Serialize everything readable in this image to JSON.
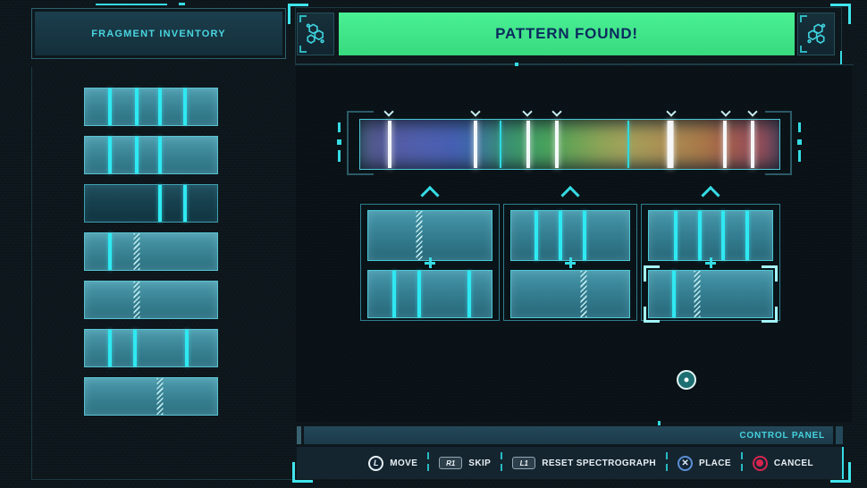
{
  "header": {
    "title": "FRAGMENT INVENTORY"
  },
  "banner": {
    "text": "PATTERN FOUND!",
    "bg_color": "#3fe98c",
    "text_color": "#0c2a5e"
  },
  "colors": {
    "accent_cyan": "#36dbe3",
    "bright_line": "#2fe9f2",
    "cross_blue": "#5b8fd6",
    "circle_red": "#d6254d"
  },
  "icons": {
    "left": "molecule-icon",
    "right": "molecule-icon",
    "spectro_marker": "chevron-down-icon",
    "column_marker": "chevron-up-icon",
    "combine": "plus-icon"
  },
  "sidebar": {
    "fragments": [
      {
        "variant": "normal",
        "lines": [
          {
            "pct": 19,
            "type": "solid"
          },
          {
            "pct": 39,
            "type": "solid"
          },
          {
            "pct": 57,
            "type": "solid"
          },
          {
            "pct": 76,
            "type": "solid"
          }
        ]
      },
      {
        "variant": "normal",
        "lines": [
          {
            "pct": 19,
            "type": "solid"
          },
          {
            "pct": 39,
            "type": "solid"
          },
          {
            "pct": 57,
            "type": "solid"
          }
        ]
      },
      {
        "variant": "dark",
        "lines": [
          {
            "pct": 57,
            "type": "solid"
          },
          {
            "pct": 76,
            "type": "solid"
          }
        ]
      },
      {
        "variant": "normal",
        "lines": [
          {
            "pct": 19,
            "type": "solid"
          },
          {
            "pct": 39,
            "type": "hatched"
          }
        ]
      },
      {
        "variant": "normal",
        "lines": [
          {
            "pct": 39,
            "type": "hatched"
          }
        ]
      },
      {
        "variant": "normal",
        "lines": [
          {
            "pct": 19,
            "type": "solid"
          },
          {
            "pct": 38,
            "type": "solid"
          },
          {
            "pct": 77,
            "type": "solid"
          }
        ]
      },
      {
        "variant": "normal",
        "lines": [
          {
            "pct": 57,
            "type": "hatched"
          }
        ]
      }
    ]
  },
  "spectrograph": {
    "gradient": [
      {
        "pos": 0,
        "color": "#35506b"
      },
      {
        "pos": 3,
        "color": "#50568b"
      },
      {
        "pos": 8,
        "color": "#545ca4"
      },
      {
        "pos": 15,
        "color": "#4f5fae"
      },
      {
        "pos": 22,
        "color": "#465fb2"
      },
      {
        "pos": 26,
        "color": "#3f66ab"
      },
      {
        "pos": 29,
        "color": "#3d7996"
      },
      {
        "pos": 33,
        "color": "#398a7d"
      },
      {
        "pos": 38,
        "color": "#3d9869"
      },
      {
        "pos": 44,
        "color": "#47a15d"
      },
      {
        "pos": 50,
        "color": "#66a356"
      },
      {
        "pos": 57,
        "color": "#8ba457"
      },
      {
        "pos": 63,
        "color": "#a3a15a"
      },
      {
        "pos": 70,
        "color": "#a99455"
      },
      {
        "pos": 76,
        "color": "#aa8750"
      },
      {
        "pos": 82,
        "color": "#a87647"
      },
      {
        "pos": 87,
        "color": "#a2614b"
      },
      {
        "pos": 91,
        "color": "#9b5454"
      },
      {
        "pos": 96,
        "color": "#8c4b57"
      },
      {
        "pos": 100,
        "color": "#4f3a4f"
      }
    ],
    "markers": [
      {
        "pct": 7,
        "w": 4
      },
      {
        "pct": 27.5,
        "w": 4
      },
      {
        "pct": 40,
        "w": 4
      },
      {
        "pct": 47,
        "w": 4
      },
      {
        "pct": 74,
        "w": 7
      },
      {
        "pct": 87,
        "w": 4
      },
      {
        "pct": 93.5,
        "w": 4
      }
    ],
    "dividers": [
      33.5,
      64
    ]
  },
  "puzzle": {
    "columns": [
      {
        "top": {
          "lines": [
            {
              "pct": 41,
              "type": "hatched"
            }
          ],
          "selected": false
        },
        "bottom": {
          "lines": [
            {
              "pct": 21,
              "type": "solid"
            },
            {
              "pct": 41,
              "type": "solid"
            },
            {
              "pct": 82,
              "type": "solid"
            }
          ],
          "selected": false
        }
      },
      {
        "top": {
          "lines": [
            {
              "pct": 21,
              "type": "solid"
            },
            {
              "pct": 42,
              "type": "solid"
            },
            {
              "pct": 62,
              "type": "solid"
            }
          ],
          "selected": false
        },
        "bottom": {
          "lines": [
            {
              "pct": 61,
              "type": "hatched"
            }
          ],
          "selected": false
        }
      },
      {
        "top": {
          "lines": [
            {
              "pct": 22,
              "type": "solid"
            },
            {
              "pct": 41,
              "type": "solid"
            },
            {
              "pct": 60,
              "type": "solid"
            },
            {
              "pct": 80,
              "type": "solid"
            }
          ],
          "selected": false
        },
        "bottom": {
          "lines": [
            {
              "pct": 20,
              "type": "solid"
            },
            {
              "pct": 39,
              "type": "hatched"
            }
          ],
          "selected": true
        }
      }
    ]
  },
  "control_panel": {
    "label": "CONTROL PANEL",
    "buttons": [
      {
        "icon": "l-stick-icon",
        "key": "L",
        "label": "MOVE"
      },
      {
        "icon": "r1-button-icon",
        "key": "R1",
        "label": "SKIP"
      },
      {
        "icon": "l1-button-icon",
        "key": "L1",
        "label": "RESET SPECTROGRAPH"
      },
      {
        "icon": "cross-button-icon",
        "key": "✕",
        "label": "PLACE"
      },
      {
        "icon": "circle-button-icon",
        "key": "",
        "label": "CANCEL"
      }
    ]
  }
}
